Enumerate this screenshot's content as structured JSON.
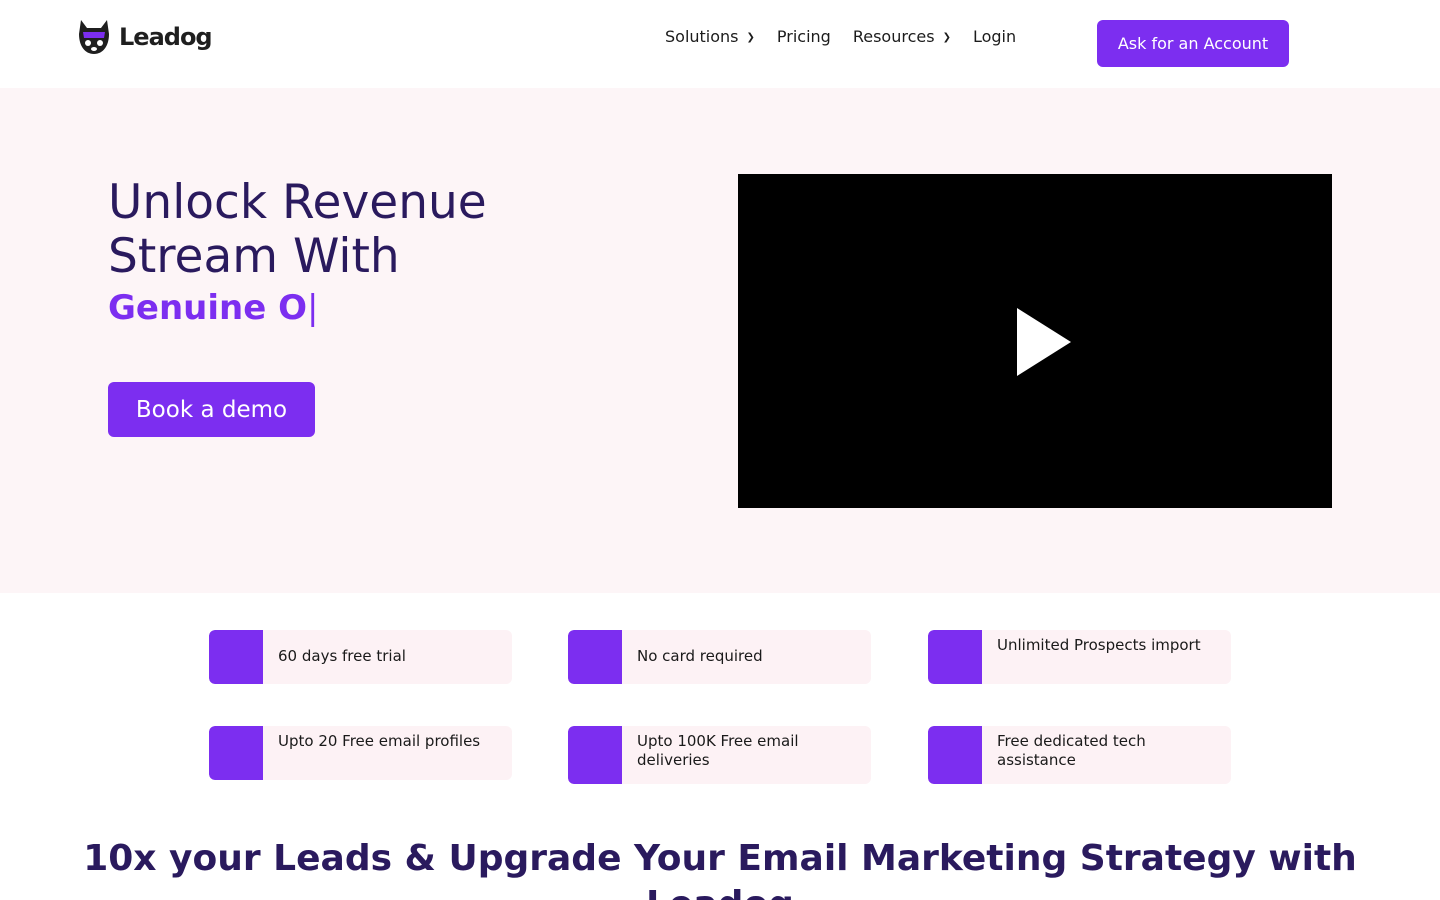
{
  "brand": {
    "name": "Leadog",
    "accent": "#7c2ef0",
    "dark_text": "#2a1a5e",
    "hero_bg": "#fdf5f7"
  },
  "nav": {
    "items": [
      {
        "label": "Solutions",
        "icon": "chevron-down-icon"
      },
      {
        "label": "Pricing"
      },
      {
        "label": "Resources",
        "icon": "chevron-down-icon"
      },
      {
        "label": "Login"
      }
    ],
    "cta_label": "Ask for an Account"
  },
  "hero": {
    "title": "Unlock Revenue Stream With",
    "typed_text": "Genuine O",
    "caret": "|",
    "button_label": "Book a demo",
    "video_icon": "play-icon"
  },
  "features": [
    {
      "text": "60 days free trial"
    },
    {
      "text": "No card required"
    },
    {
      "text": "Unlimited Prospects import"
    },
    {
      "text": "Upto 20 Free email profiles"
    },
    {
      "text": "Upto 100K Free email deliveries"
    },
    {
      "text": "Free dedicated tech assistance"
    }
  ],
  "section": {
    "headline": "10x your Leads & Upgrade Your Email Marketing Strategy with",
    "headline_cont": "Leadog"
  }
}
